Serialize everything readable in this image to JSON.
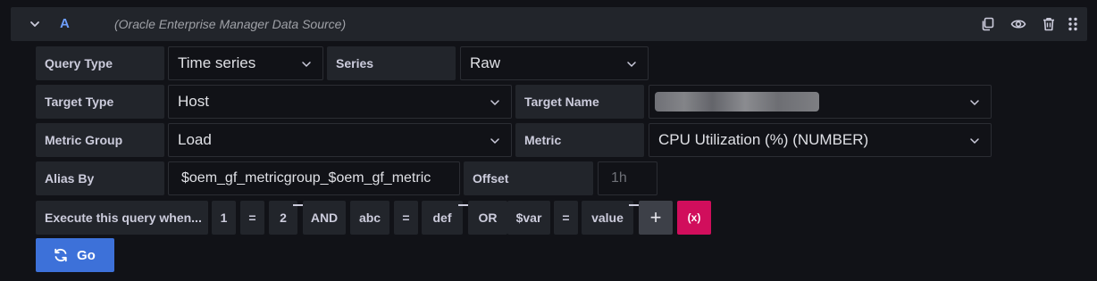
{
  "query": {
    "ref_id": "A",
    "datasource": "(Oracle Enterprise Manager Data Source)"
  },
  "header_icons": [
    "copy-icon",
    "eye-icon",
    "trash-icon",
    "drag-handle-icon"
  ],
  "rows": {
    "query_type_label": "Query Type",
    "query_type_value": "Time series",
    "series_label": "Series",
    "series_value": "Raw",
    "target_type_label": "Target Type",
    "target_type_value": "Host",
    "target_name_label": "Target Name",
    "metric_group_label": "Metric Group",
    "metric_group_value": "Load",
    "metric_label": "Metric",
    "metric_value": "CPU Utilization (%) (NUMBER)",
    "alias_label": "Alias By",
    "alias_value": "$oem_gf_metricgroup_$oem_gf_metric",
    "offset_label": "Offset",
    "offset_placeholder": "1h"
  },
  "condition": {
    "label": "Execute this query when...",
    "tokens": [
      "1",
      "=",
      "2",
      "AND",
      "abc",
      "=",
      "def",
      "OR",
      "$var",
      "=",
      "value"
    ],
    "add_label": "+",
    "variable_label": "(x)"
  },
  "go_label": "Go",
  "colors": {
    "background": "#111217",
    "label_bg": "#22252b",
    "accent_blue": "#3d71d9",
    "ref_blue": "#6e9fff",
    "variable_pink": "#d10e5c"
  }
}
